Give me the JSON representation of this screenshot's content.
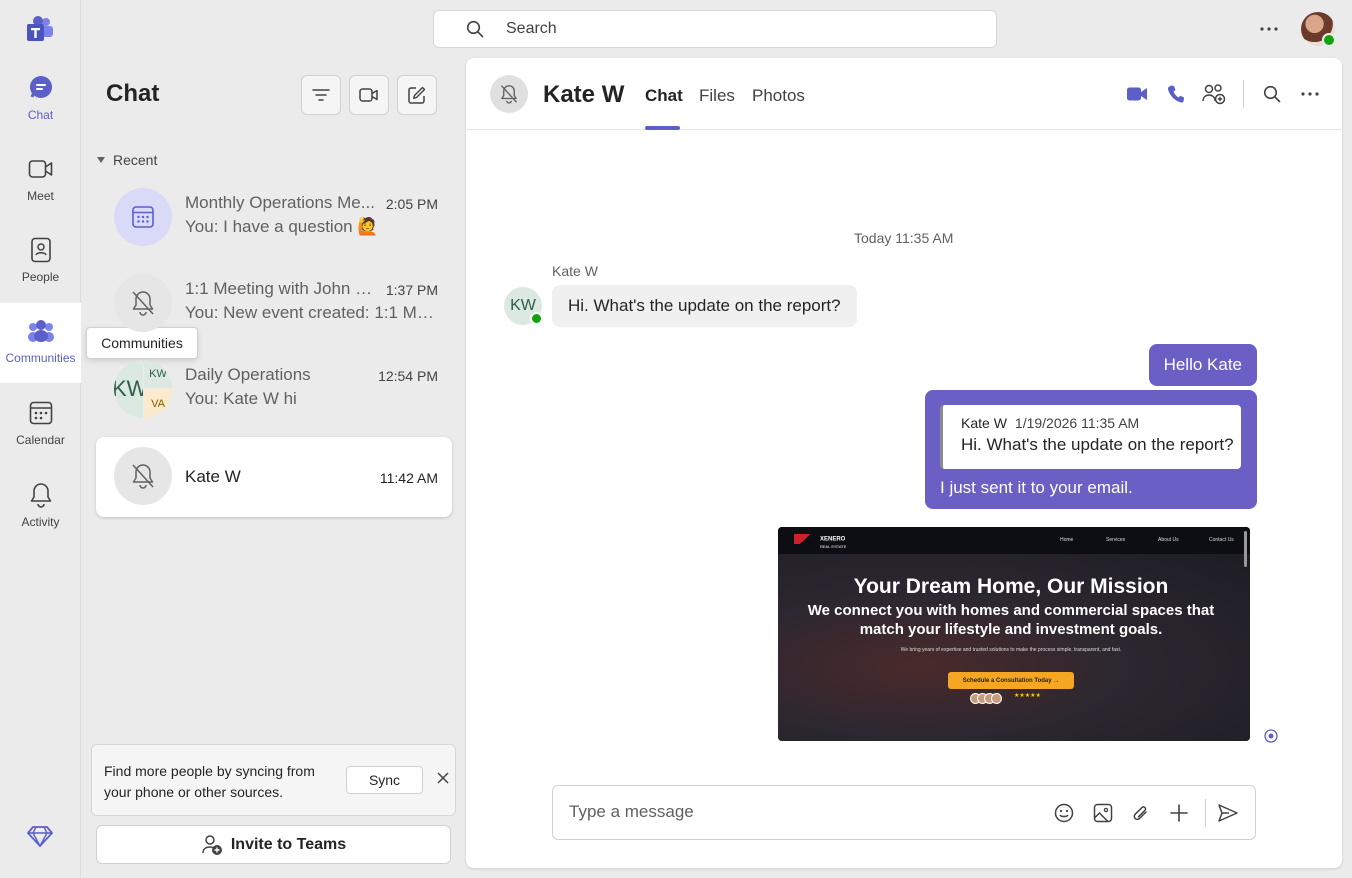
{
  "rail": {
    "items": [
      {
        "label": "Chat",
        "icon": "chat-icon"
      },
      {
        "label": "Meet",
        "icon": "video-icon"
      },
      {
        "label": "People",
        "icon": "people-book-icon"
      },
      {
        "label": "Communities",
        "icon": "communities-icon"
      },
      {
        "label": "Calendar",
        "icon": "calendar-icon"
      },
      {
        "label": "Activity",
        "icon": "bell-icon"
      }
    ],
    "tooltip": "Communities"
  },
  "search": {
    "placeholder": "Search"
  },
  "list": {
    "title": "Chat",
    "section": "Recent",
    "items": [
      {
        "name": "Monthly Operations Me...",
        "time": "2:05 PM",
        "preview": "You: I have a question 🙋"
      },
      {
        "name": "1:1 Meeting with John D...",
        "time": "1:37 PM",
        "preview": "You: New event created: 1:1 Mee..."
      },
      {
        "name": "Daily Operations",
        "time": "12:54 PM",
        "preview": "You: Kate W hi",
        "avatar_initials": [
          "KW",
          "KW",
          "VA"
        ]
      },
      {
        "name": "Kate W",
        "time": "11:42 AM",
        "preview": ""
      }
    ],
    "sync": {
      "text": "Find more people by syncing from your phone or other sources.",
      "button": "Sync"
    },
    "invite": "Invite to Teams"
  },
  "chat": {
    "name": "Kate W",
    "tabs": [
      "Chat",
      "Files",
      "Photos"
    ],
    "day_divider": "Today 11:35 AM",
    "incoming": {
      "sender": "Kate W",
      "initials": "KW",
      "text": "Hi. What's the update on the report?"
    },
    "outgoing_1": "Hello Kate",
    "reply": {
      "quote_name": "Kate W",
      "quote_time": "1/19/2026 11:35 AM",
      "quote_text": "Hi. What's the update on the report?",
      "text": "I just sent it to your email."
    },
    "screenshot": {
      "brand": "XENERO",
      "brand_sub": "REAL ESTATE",
      "nav": [
        "Home",
        "Services",
        "About Us",
        "Contact Us"
      ],
      "headline": "Your Dream Home, Our Mission",
      "subheadline": "We connect you with homes and commercial spaces that match your lifestyle and investment goals.",
      "small": "We bring years of expertise and trusted solutions to make the process simple, transparent, and fast.",
      "cta": "Schedule a Consultation Today →",
      "rating": "★★★★★"
    },
    "compose_placeholder": "Type a message"
  },
  "colors": {
    "brand": "#5b5fc7",
    "bubble_out": "#6a5fc4",
    "online": "#13a10e"
  }
}
